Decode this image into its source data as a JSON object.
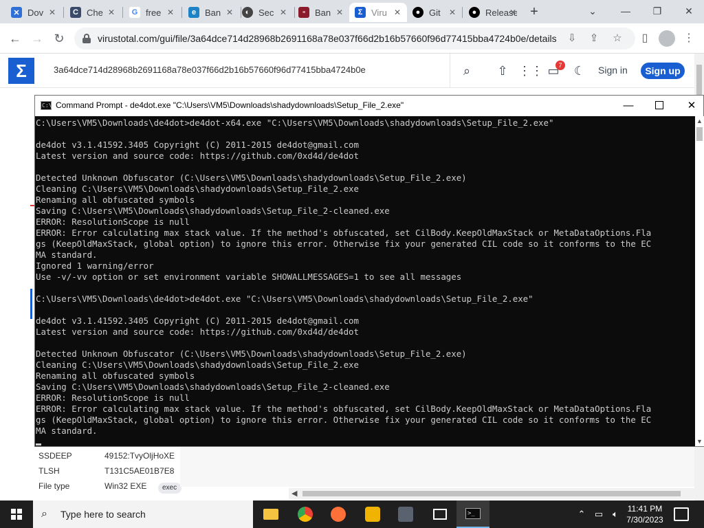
{
  "browser": {
    "tabs": [
      {
        "label": "Dov",
        "favicon": "malware-site-icon",
        "color": "#2f6fd6"
      },
      {
        "label": "Che",
        "favicon": "checkpoint-icon",
        "color": "#3b4a6b"
      },
      {
        "label": "free",
        "favicon": "google-icon",
        "color": "#4285f4"
      },
      {
        "label": "Ban",
        "favicon": "edge-icon",
        "color": "#1c83c7"
      },
      {
        "label": "Sec",
        "favicon": "security-icon",
        "color": "#444444"
      },
      {
        "label": "Ban",
        "favicon": "red-site-icon",
        "color": "#8b1a2b"
      },
      {
        "label": "Viru",
        "favicon": "virustotal-icon",
        "color": "#1a5fd1",
        "active": true
      },
      {
        "label": "Git",
        "favicon": "github-icon",
        "color": "#000000"
      },
      {
        "label": "Release",
        "favicon": "github-icon",
        "color": "#000000"
      }
    ],
    "url": "virustotal.com/gui/file/3a64dce714d28968b2691168a78e037f66d2b16b57660f96d77415bba4724b0e/details"
  },
  "virustotal": {
    "search_value": "3a64dce714d28968b2691168a78e037f66d2b16b57660f96d77415bba4724b0e",
    "notification_count": "7",
    "signin_label": "Sign in",
    "signup_label": "Sign up",
    "details": [
      {
        "key": "SSDEEP",
        "value": "49152:TvyOljHoXE"
      },
      {
        "key": "TLSH",
        "value": "T131C5AE01B7E8"
      },
      {
        "key": "File type",
        "value": "Win32 EXE"
      }
    ],
    "exec_tag": "exec"
  },
  "console": {
    "title": "Command Prompt - de4dot.exe  \"C:\\Users\\VM5\\Downloads\\shadydownloads\\Setup_File_2.exe\"",
    "lines": [
      "C:\\Users\\VM5\\Downloads\\de4dot>de4dot-x64.exe \"C:\\Users\\VM5\\Downloads\\shadydownloads\\Setup_File_2.exe\"",
      "",
      "de4dot v3.1.41592.3405 Copyright (C) 2011-2015 de4dot@gmail.com",
      "Latest version and source code: https://github.com/0xd4d/de4dot",
      "",
      "Detected Unknown Obfuscator (C:\\Users\\VM5\\Downloads\\shadydownloads\\Setup_File_2.exe)",
      "Cleaning C:\\Users\\VM5\\Downloads\\shadydownloads\\Setup_File_2.exe",
      "Renaming all obfuscated symbols",
      "Saving C:\\Users\\VM5\\Downloads\\shadydownloads\\Setup_File_2-cleaned.exe",
      "ERROR: ResolutionScope is null",
      "ERROR: Error calculating max stack value. If the method's obfuscated, set CilBody.KeepOldMaxStack or MetaDataOptions.Fla",
      "gs (KeepOldMaxStack, global option) to ignore this error. Otherwise fix your generated CIL code so it conforms to the EC",
      "MA standard.",
      "Ignored 1 warning/error",
      "Use -v/-vv option or set environment variable SHOWALLMESSAGES=1 to see all messages",
      "",
      "C:\\Users\\VM5\\Downloads\\de4dot>de4dot.exe \"C:\\Users\\VM5\\Downloads\\shadydownloads\\Setup_File_2.exe\"",
      "",
      "de4dot v3.1.41592.3405 Copyright (C) 2011-2015 de4dot@gmail.com",
      "Latest version and source code: https://github.com/0xd4d/de4dot",
      "",
      "Detected Unknown Obfuscator (C:\\Users\\VM5\\Downloads\\shadydownloads\\Setup_File_2.exe)",
      "Cleaning C:\\Users\\VM5\\Downloads\\shadydownloads\\Setup_File_2.exe",
      "Renaming all obfuscated symbols",
      "Saving C:\\Users\\VM5\\Downloads\\shadydownloads\\Setup_File_2-cleaned.exe",
      "ERROR: ResolutionScope is null",
      "ERROR: Error calculating max stack value. If the method's obfuscated, set CilBody.KeepOldMaxStack or MetaDataOptions.Fla",
      "gs (KeepOldMaxStack, global option) to ignore this error. Otherwise fix your generated CIL code so it conforms to the EC",
      "MA standard."
    ]
  },
  "taskbar": {
    "search_placeholder": "Type here to search",
    "time": "11:41 PM",
    "date": "7/30/2023"
  }
}
